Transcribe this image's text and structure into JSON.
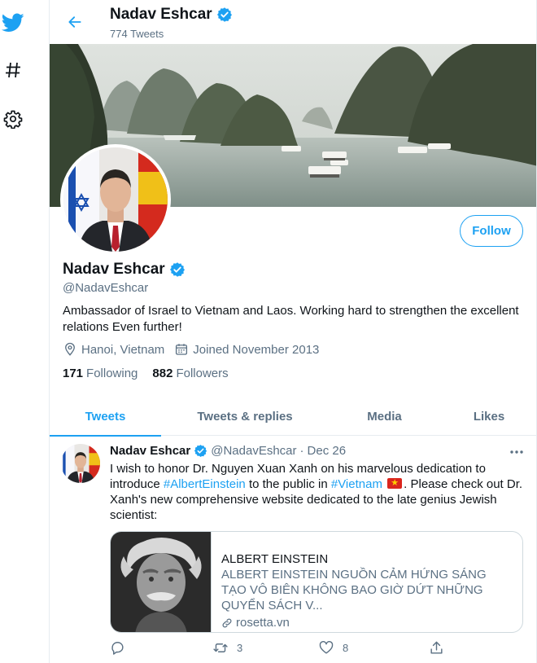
{
  "header": {
    "name": "Nadav Eshcar",
    "tweet_count": "774 Tweets"
  },
  "profile": {
    "name": "Nadav Eshcar",
    "handle": "@NadavEshcar",
    "bio": "Ambassador of Israel to Vietnam and Laos. Working hard to strengthen the excellent relations Even further!",
    "location": "Hanoi, Vietnam",
    "joined": "Joined November 2013",
    "following_count": "171",
    "following_label": "Following",
    "followers_count": "882",
    "followers_label": "Followers",
    "follow_button": "Follow"
  },
  "tabs": [
    {
      "label": "Tweets"
    },
    {
      "label": "Tweets & replies"
    },
    {
      "label": "Media"
    },
    {
      "label": "Likes"
    }
  ],
  "tweet": {
    "name": "Nadav Eshcar",
    "handle": "@NadavEshcar",
    "separator": "·",
    "date": "Dec 26",
    "text_1": "I wish to honor Dr. Nguyen Xuan Xanh on his marvelous dedication to introduce ",
    "hashtag_1": "#AlbertEinstein",
    "text_2": " to the public in ",
    "hashtag_2": "#Vietnam",
    "text_3": ". Please check out Dr. Xanh's new comprehensive website dedicated to the late genius Jewish scientist:",
    "card": {
      "title": "ALBERT EINSTEIN",
      "description": "ALBERT EINSTEIN NGUỒN CẢM HỨNG SÁNG TẠO VÔ BIÊN KHÔNG BAO GIỜ DỨT NHỮNG QUYỂN SÁCH V...",
      "domain": "rosetta.vn"
    },
    "retweets": "3",
    "likes": "8"
  },
  "colors": {
    "accent": "#1da1f2",
    "text_primary": "#0f1419",
    "text_secondary": "#5b7083"
  },
  "icons": {
    "rail": [
      "twitter-logo-icon",
      "hashtag-icon",
      "settings-gear-icon"
    ],
    "meta": [
      "location-pin-icon",
      "calendar-icon"
    ],
    "actions": [
      "reply-icon",
      "retweet-icon",
      "like-icon",
      "share-icon"
    ]
  }
}
